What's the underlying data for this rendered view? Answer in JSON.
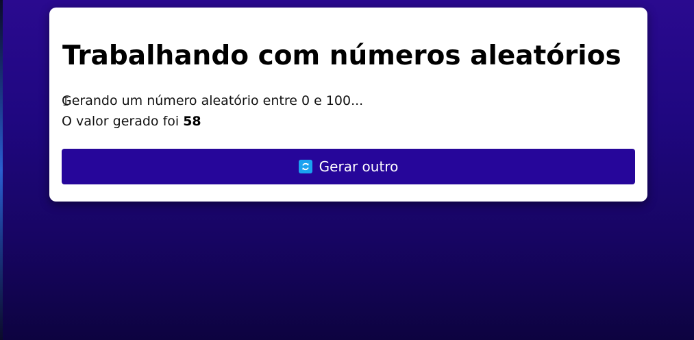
{
  "card": {
    "title": "Trabalhando com números aleatórios",
    "line1": "Gerando um número aleatório entre 0 e 100...",
    "line2_prefix": "O valor gerado foi ",
    "value": "58"
  },
  "button": {
    "label": "Gerar outro",
    "icon": "refresh-icon"
  },
  "colors": {
    "background": "#1f0780",
    "button": "#26069a",
    "icon": "#1aa3f0"
  }
}
